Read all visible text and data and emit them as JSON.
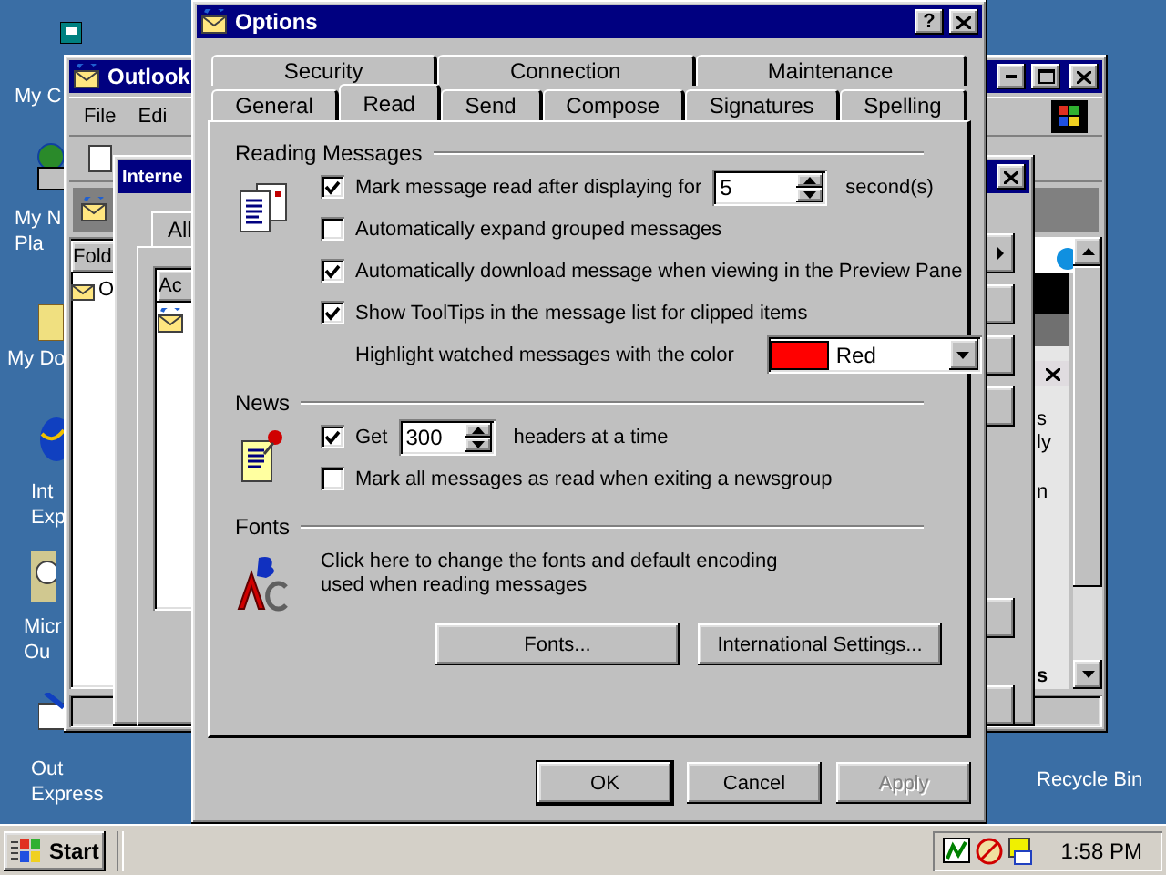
{
  "desktop": {
    "icons": [
      {
        "lines": [
          "My C"
        ]
      },
      {
        "lines": [
          "My N",
          "Pla"
        ]
      },
      {
        "lines": [
          "My Do"
        ]
      },
      {
        "lines": [
          "Int",
          "Exp"
        ]
      },
      {
        "lines": [
          "Micr",
          "Ou"
        ]
      },
      {
        "lines": [
          "Out",
          "Express"
        ]
      },
      {
        "lines": [
          "Recycle Bin"
        ]
      }
    ]
  },
  "outlook_window": {
    "title": "Outlook",
    "menu": [
      "File",
      "Edi"
    ],
    "folder_header": "Fold",
    "folder_item": "O",
    "preview_fragments": [
      "s",
      "ly",
      "n",
      "s"
    ]
  },
  "accounts_window": {
    "title": "Interne",
    "tab": "All",
    "column": "Ac"
  },
  "options_dialog": {
    "title": "Options",
    "help": "?",
    "tab_rows": [
      [
        {
          "label": "Security",
          "selected": false
        },
        {
          "label": "Connection",
          "selected": false
        },
        {
          "label": "Maintenance",
          "selected": false
        }
      ],
      [
        {
          "label": "General",
          "selected": false
        },
        {
          "label": "Read",
          "selected": true
        },
        {
          "label": "Send",
          "selected": false
        },
        {
          "label": "Compose",
          "selected": false
        },
        {
          "label": "Signatures",
          "selected": false
        },
        {
          "label": "Spelling",
          "selected": false
        }
      ]
    ],
    "sections": [
      {
        "kind": "reading",
        "title": "Reading Messages",
        "rows": [
          {
            "kind": "checkbox",
            "checked": true,
            "label": "Mark message read after displaying for",
            "spin": "5",
            "suffix": "second(s)"
          },
          {
            "kind": "checkbox",
            "checked": false,
            "label": "Automatically expand grouped messages"
          },
          {
            "kind": "checkbox",
            "checked": true,
            "label": "Automatically download message when viewing in the Preview Pane"
          },
          {
            "kind": "checkbox",
            "checked": true,
            "label": "Show ToolTips in the message list for clipped items"
          },
          {
            "kind": "color",
            "label": "Highlight watched messages with the color",
            "value": "Red",
            "color": "#ff0000"
          }
        ]
      },
      {
        "kind": "news",
        "title": "News",
        "rows": [
          {
            "kind": "checkbox",
            "checked": true,
            "label": "Get",
            "spin": "300",
            "suffix": "headers at a time"
          },
          {
            "kind": "checkbox",
            "checked": false,
            "label": "Mark all messages as read when exiting a newsgroup"
          }
        ]
      },
      {
        "kind": "fonts",
        "title": "Fonts",
        "description": "Click here to change the fonts and default encoding used when reading messages",
        "buttons": [
          "Fonts...",
          "International Settings..."
        ]
      }
    ],
    "buttons": [
      {
        "label": "OK",
        "default": true,
        "disabled": false
      },
      {
        "label": "Cancel",
        "default": false,
        "disabled": false
      },
      {
        "label": "Apply",
        "default": false,
        "disabled": true
      }
    ]
  },
  "taskbar": {
    "start": "Start",
    "clock": "1:58 PM"
  }
}
